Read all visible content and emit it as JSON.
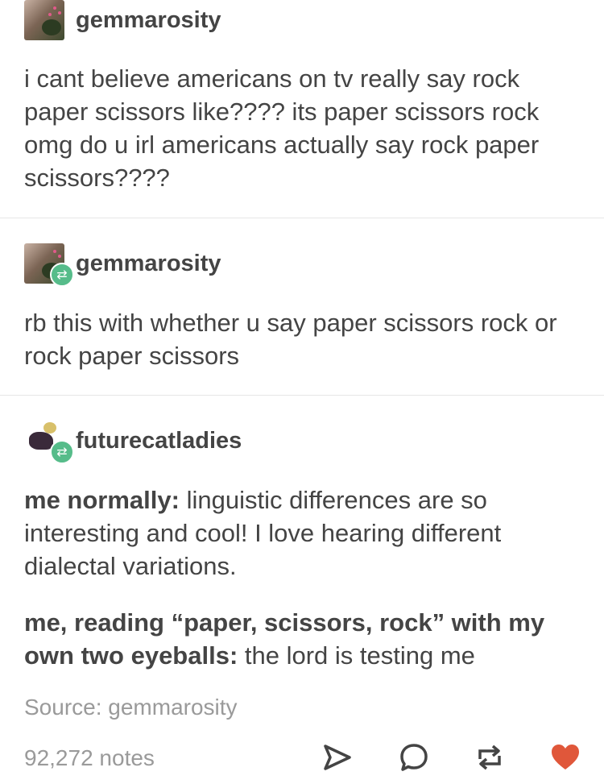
{
  "posts": [
    {
      "username": "gemmarosity",
      "body": "i cant believe americans on tv really say rock paper scissors like???? its paper scissors rock omg do u irl americans actually say rock paper scissors????"
    },
    {
      "username": "gemmarosity",
      "body": "rb this with whether u say paper scissors rock or rock paper scissors"
    },
    {
      "username": "futurecatladies",
      "para1_bold": "me normally:",
      "para1_text": " linguistic differences are so interesting and cool! I love hearing different dialectal variations.",
      "para2_bold": "me, reading “paper, scissors, rock” with my own two eyeballs:",
      "para2_text": " the lord is testing me"
    }
  ],
  "footer": {
    "source": "Source: gemmarosity",
    "notes": "92,272 notes"
  },
  "icons": {
    "share": "share-arrow-icon",
    "reply": "reply-bubble-icon",
    "reblog": "reblog-icon",
    "like": "heart-icon"
  },
  "colors": {
    "text": "#444444",
    "muted": "#9a9a9a",
    "reblog_badge": "#56bc8a",
    "like": "#e0573a",
    "divider": "#e6e6e6"
  }
}
